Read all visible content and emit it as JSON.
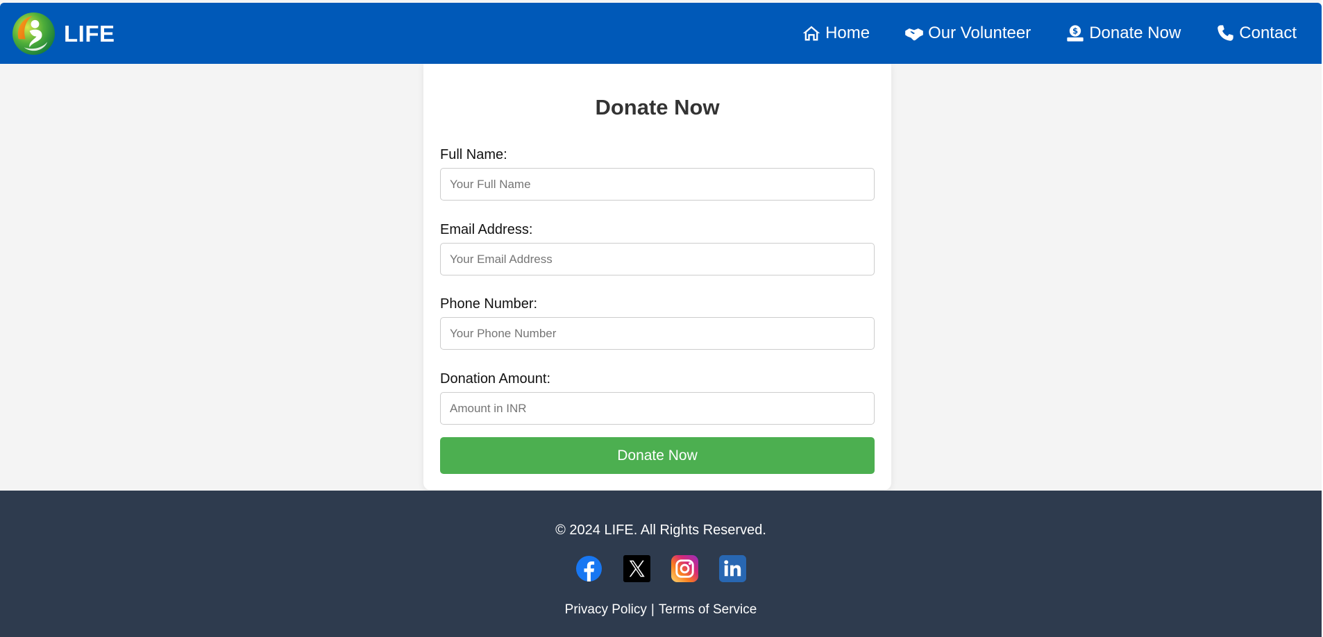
{
  "brand": {
    "name": "LIFE"
  },
  "nav": {
    "items": [
      {
        "label": "Home",
        "icon": "home-icon"
      },
      {
        "label": "Our Volunteer",
        "icon": "handshake-icon"
      },
      {
        "label": "Donate Now",
        "icon": "donate-icon"
      },
      {
        "label": "Contact",
        "icon": "phone-icon"
      }
    ]
  },
  "form": {
    "title": "Donate Now",
    "fields": [
      {
        "label": "Full Name:",
        "placeholder": "Your Full Name",
        "value": ""
      },
      {
        "label": "Email Address:",
        "placeholder": "Your Email Address",
        "value": ""
      },
      {
        "label": "Phone Number:",
        "placeholder": "Your Phone Number",
        "value": ""
      },
      {
        "label": "Donation Amount:",
        "placeholder": "Amount in INR",
        "value": ""
      }
    ],
    "submit_label": "Donate Now"
  },
  "footer": {
    "copyright": "© 2024 LIFE. All Rights Reserved.",
    "socials": [
      "facebook-icon",
      "x-icon",
      "instagram-icon",
      "linkedin-icon"
    ],
    "links": [
      "Privacy Policy",
      "Terms of Service"
    ],
    "separator": "|"
  },
  "colors": {
    "header": "#0059b8",
    "button": "#4caf50",
    "footer": "#2e3b4e",
    "page_bg": "#f4f4f4"
  }
}
